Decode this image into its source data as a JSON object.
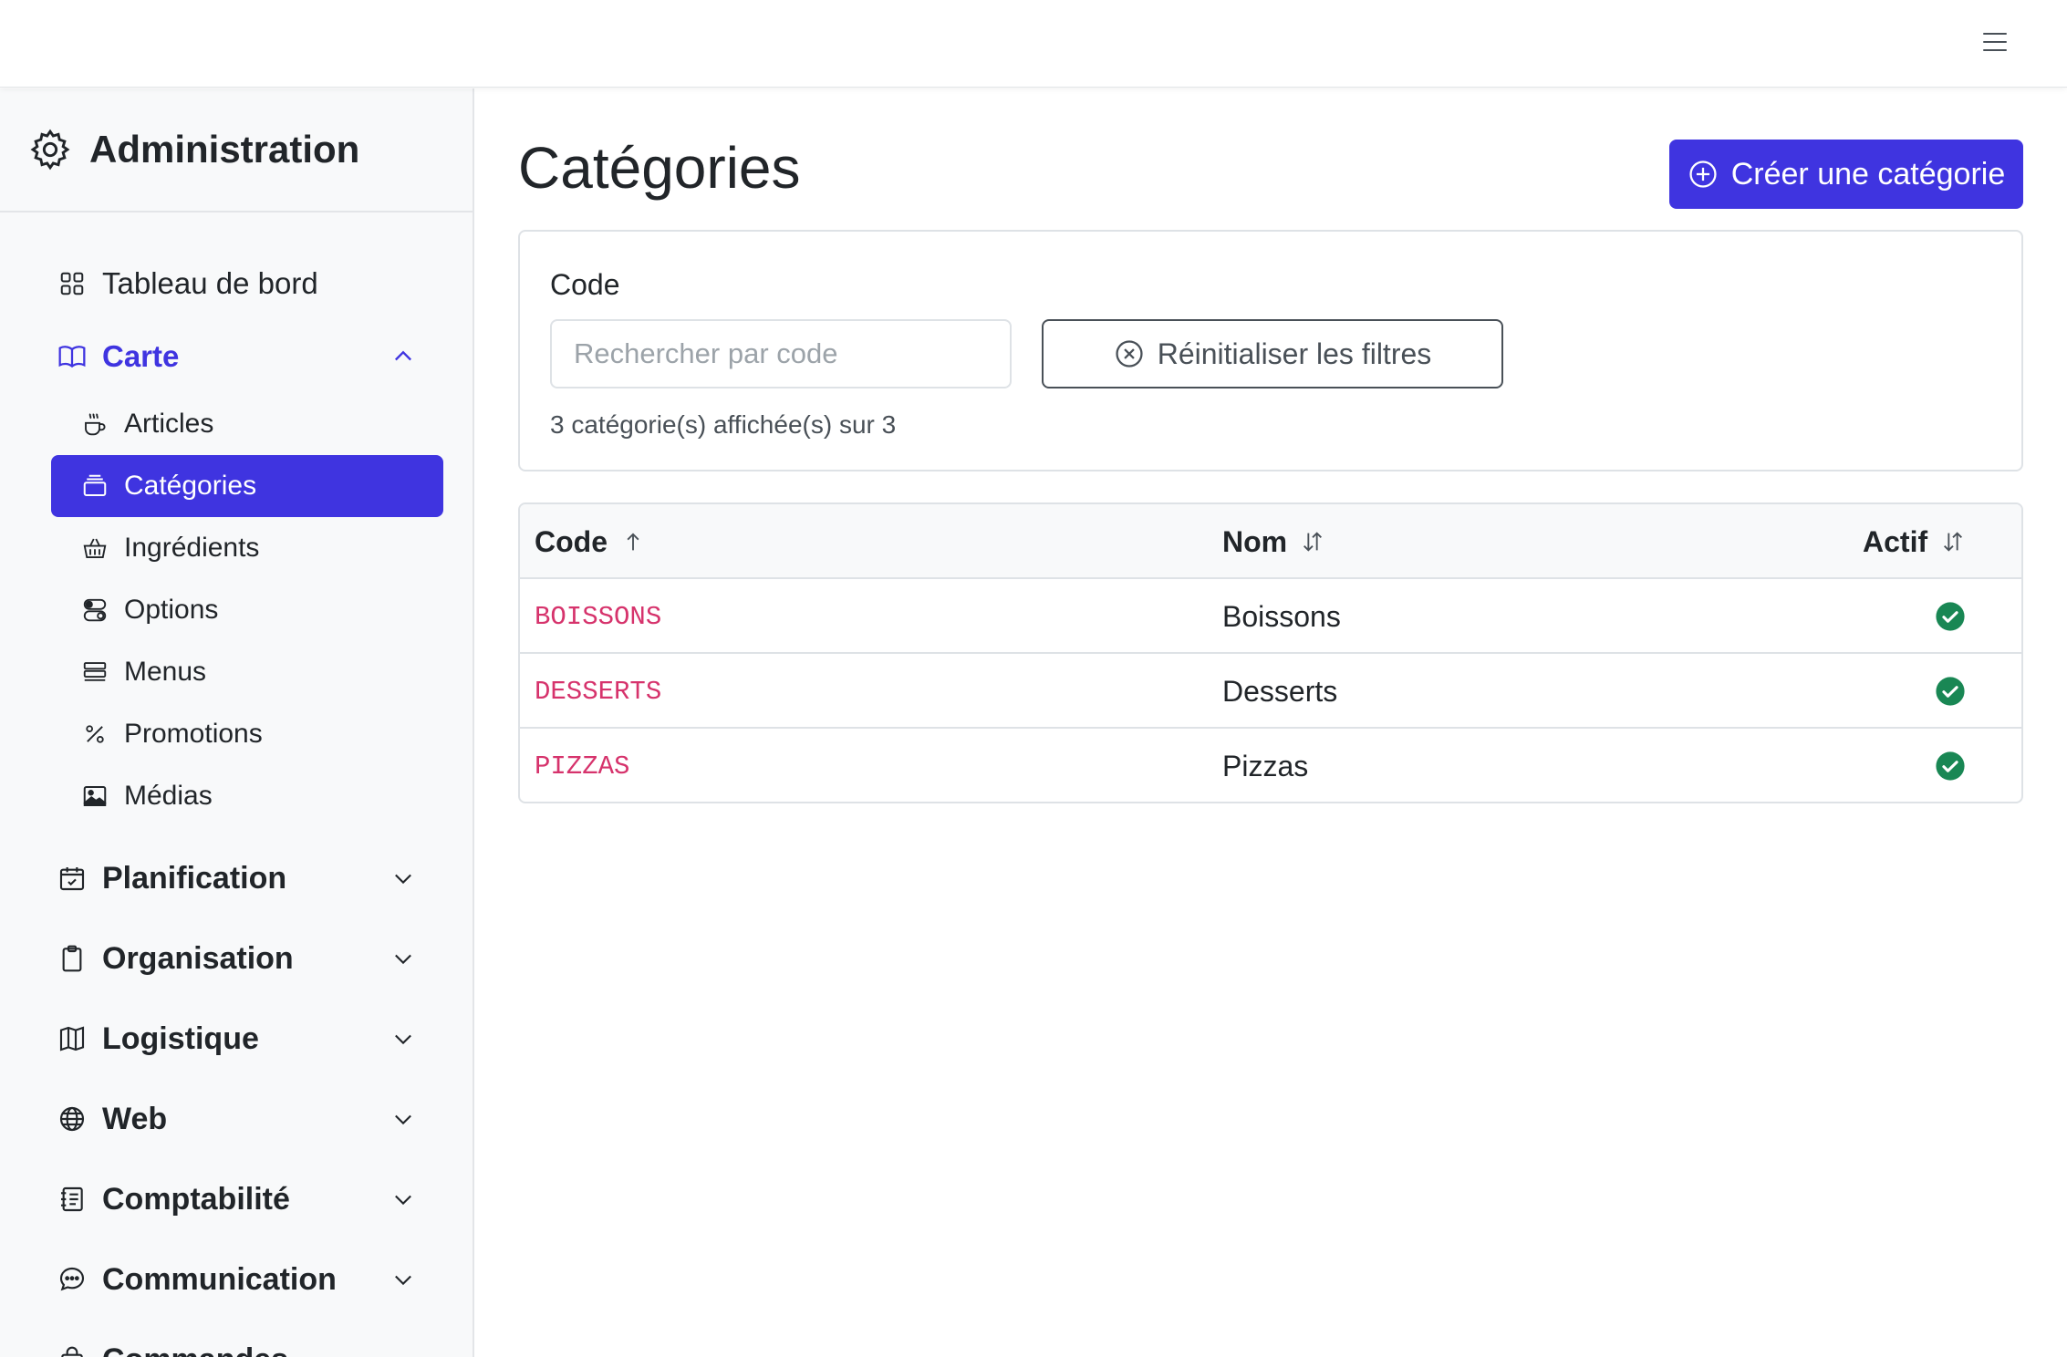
{
  "sidebar": {
    "brand_title": "Administration",
    "items": [
      {
        "label": "Tableau de bord",
        "icon": "grid-icon"
      },
      {
        "label": "Carte",
        "icon": "book-icon",
        "open": true
      }
    ],
    "carte_children": [
      {
        "label": "Articles",
        "icon": "cup-hot-icon"
      },
      {
        "label": "Catégories",
        "icon": "layers-icon",
        "active": true
      },
      {
        "label": "Ingrédients",
        "icon": "basket-icon"
      },
      {
        "label": "Options",
        "icon": "toggles-icon"
      },
      {
        "label": "Menus",
        "icon": "stack-icon"
      },
      {
        "label": "Promotions",
        "icon": "percent-icon"
      },
      {
        "label": "Médias",
        "icon": "image-icon"
      }
    ],
    "groups": [
      {
        "label": "Planification",
        "icon": "calendar-check-icon"
      },
      {
        "label": "Organisation",
        "icon": "clipboard-icon"
      },
      {
        "label": "Logistique",
        "icon": "map-icon"
      },
      {
        "label": "Web",
        "icon": "globe-icon"
      },
      {
        "label": "Comptabilité",
        "icon": "journal-icon"
      },
      {
        "label": "Communication",
        "icon": "chat-icon"
      },
      {
        "label": "Commandes",
        "icon": "bag-icon"
      }
    ]
  },
  "header": {
    "page_title": "Catégories",
    "create_button": "Créer une catégorie"
  },
  "filters": {
    "code_label": "Code",
    "search_placeholder": "Rechercher par code",
    "search_value": "",
    "reset_button": "Réinitialiser les filtres",
    "count_text": "3 catégorie(s) affichée(s) sur 3"
  },
  "table": {
    "columns": [
      {
        "label": "Code",
        "sort": "asc"
      },
      {
        "label": "Nom",
        "sort": "none"
      },
      {
        "label": "Actif",
        "sort": "none"
      }
    ],
    "rows": [
      {
        "code": "BOISSONS",
        "name": "Boissons",
        "active": true
      },
      {
        "code": "DESSERTS",
        "name": "Desserts",
        "active": true
      },
      {
        "code": "PIZZAS",
        "name": "Pizzas",
        "active": true
      }
    ]
  },
  "colors": {
    "accent": "#3f34e0",
    "code_text": "#d6336c",
    "success": "#198754"
  }
}
